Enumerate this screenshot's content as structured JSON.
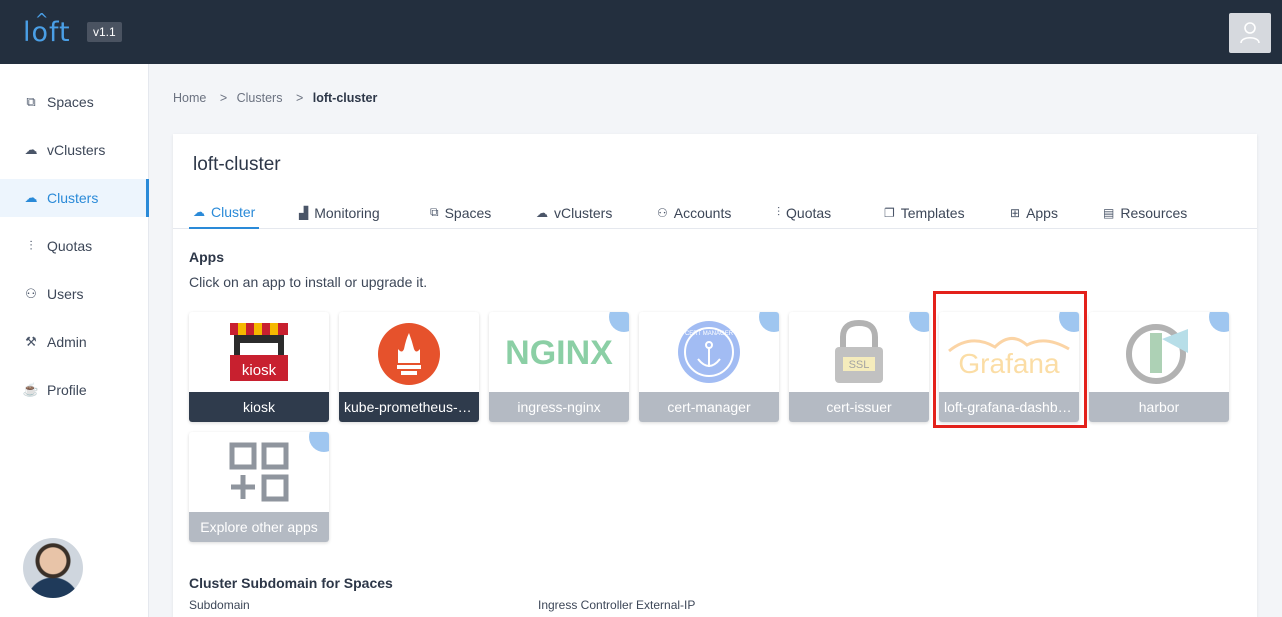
{
  "header": {
    "logo": "loft",
    "version": "v1.1",
    "user_icon": "user-icon"
  },
  "sidebar": {
    "items": [
      {
        "label": "Spaces",
        "icon": "spaces-icon"
      },
      {
        "label": "vClusters",
        "icon": "vclusters-icon"
      },
      {
        "label": "Clusters",
        "icon": "cloud-icon",
        "active": true
      },
      {
        "label": "Quotas",
        "icon": "quotas-icon"
      },
      {
        "label": "Users",
        "icon": "user-icon"
      },
      {
        "label": "Admin",
        "icon": "wrench-icon"
      },
      {
        "label": "Profile",
        "icon": "profile-icon"
      }
    ]
  },
  "breadcrumb": {
    "home": "Home",
    "clusters": "Clusters",
    "current": "loft-cluster",
    "sep": ">"
  },
  "cluster": {
    "title": "loft-cluster",
    "tabs": [
      {
        "label": "Cluster",
        "active": true
      },
      {
        "label": "Monitoring"
      },
      {
        "label": "Spaces"
      },
      {
        "label": "vClusters"
      },
      {
        "label": "Accounts"
      },
      {
        "label": "Quotas"
      },
      {
        "label": "Templates"
      },
      {
        "label": "Apps"
      },
      {
        "label": "Resources"
      }
    ],
    "apps_title": "Apps",
    "apps_subtitle": "Click on an app to install or upgrade it.",
    "apps": [
      {
        "label": "kiosk",
        "installed": true
      },
      {
        "label": "kube-prometheus-stack",
        "installed": true
      },
      {
        "label": "ingress-nginx",
        "installed": false
      },
      {
        "label": "cert-manager",
        "installed": false
      },
      {
        "label": "cert-issuer",
        "installed": false
      },
      {
        "label": "loft-grafana-dashboards",
        "installed": false
      },
      {
        "label": "harbor",
        "installed": false
      },
      {
        "label": "Explore other apps",
        "installed": false
      }
    ],
    "subdomain_title": "Cluster Subdomain for Spaces",
    "subdomain_label": "Subdomain",
    "ingress_label": "Ingress Controller External-IP"
  },
  "logo_texts": {
    "kiosk": "kiosk",
    "nginx": "NGINX",
    "certmanager": "CERT MANAGER",
    "ssl": "SSL",
    "grafana": "Grafana"
  },
  "colors": {
    "accent": "#2a8ad8",
    "topbar": "#232f3e",
    "highlight": "#e3211b"
  }
}
